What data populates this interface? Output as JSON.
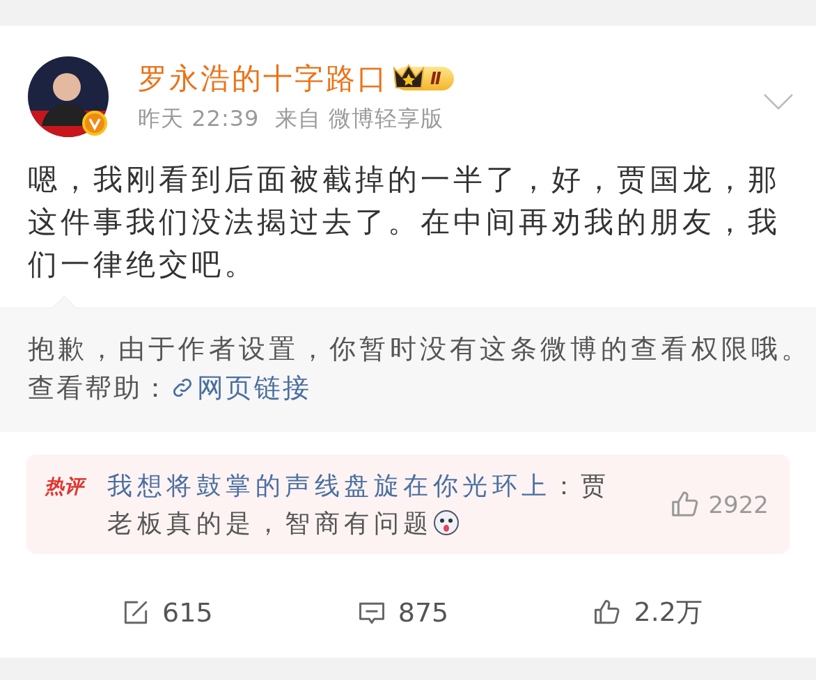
{
  "post": {
    "author": "罗永浩的十字路口",
    "level_badge": "Ⅱ",
    "verified": true,
    "time": "昨天 22:39",
    "source": "来自 微博轻享版",
    "text": "嗯，我刚看到后面被截掉的一半了，好，贾国龙，那这件事我们没法揭过去了。在中间再劝我的朋友，我们一律绝交吧。"
  },
  "quoted": {
    "notice": "抱歉，由于作者设置，你暂时没有这条微博的查看权限哦。",
    "help_label": "查看帮助：",
    "link": "网页链接"
  },
  "hot_comment": {
    "tag": "热评",
    "user": "我想将鼓掌的声线盘旋在你光环上",
    "text": "：贾老板真的是，智商有问题",
    "likes": "2922"
  },
  "actions": [
    {
      "kind": "repost",
      "count": "615"
    },
    {
      "kind": "comment",
      "count": "875"
    },
    {
      "kind": "like",
      "count": "2.2万"
    }
  ]
}
